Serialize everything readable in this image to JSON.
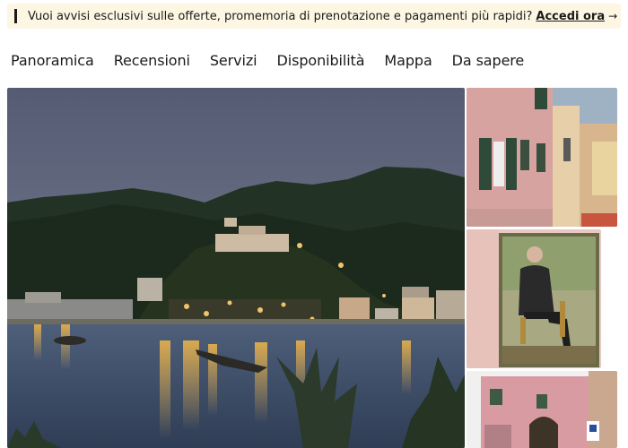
{
  "banner": {
    "message": "Vuoi avvisi esclusivi sulle offerte, promemoria di prenotazione e pagamenti più rapidi?",
    "link_label": "Accedi ora",
    "arrow_icon": "arrow-right-icon"
  },
  "nav": {
    "tabs": [
      {
        "label": "Panoramica"
      },
      {
        "label": "Recensioni"
      },
      {
        "label": "Servizi"
      },
      {
        "label": "Disponibilità"
      },
      {
        "label": "Mappa"
      },
      {
        "label": "Da sapere"
      }
    ]
  },
  "gallery": {
    "photos": [
      {
        "subject": "coastal village at dusk with hills and sea"
      },
      {
        "subject": "pastel buildings in narrow street"
      },
      {
        "subject": "painted portrait of seated man"
      },
      {
        "subject": "pink building with archway"
      }
    ]
  },
  "colors": {
    "banner_bg": "#fdf6e3",
    "text": "#1a1a1a"
  }
}
